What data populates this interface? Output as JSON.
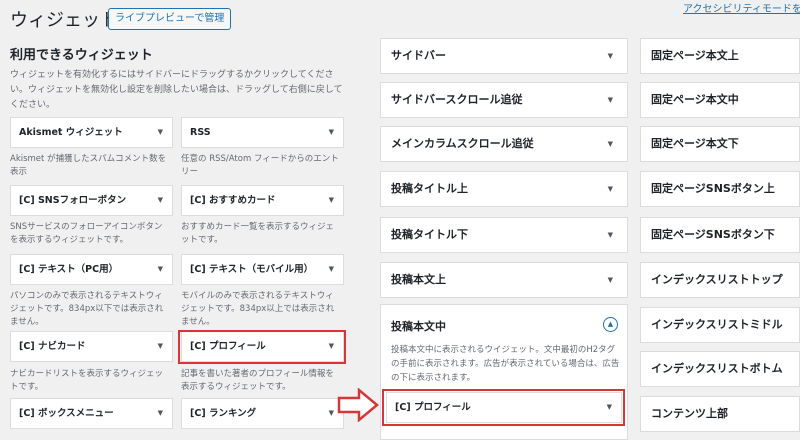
{
  "header": {
    "title": "ウィジェット",
    "live_preview_label": "ライブプレビューで管理",
    "accessibility_link": "アクセシビリティモードを有効"
  },
  "available": {
    "title": "利用できるウィジェット",
    "description": "ウィジェットを有効化するにはサイドバーにドラッグするかクリックしてください。ウィジェットを無効化し設定を削除したい場合は、ドラッグして右側に戻してください。"
  },
  "widgets": [
    {
      "name": "Akismet ウィジェット",
      "desc": "Akismet が捕獲したスパムコメント数を表示"
    },
    {
      "name": "RSS",
      "desc": "任意の RSS/Atom フィードからのエントリー"
    },
    {
      "name": "[C] SNSフォローボタン",
      "desc": "SNSサービスのフォローアイコンボタンを表示するウィジェットです。"
    },
    {
      "name": "[C] おすすめカード",
      "desc": "おすすめカード一覧を表示するウィジェットです。"
    },
    {
      "name": "[C] テキスト（PC用）",
      "desc": "パソコンのみで表示されるテキストウィジェットです。834px以下では表示されません。"
    },
    {
      "name": "[C] テキスト（モバイル用）",
      "desc": "モバイルのみで表示されるテキストウィジェットです。834px以上では表示されません。"
    },
    {
      "name": "[C] ナビカード",
      "desc": "ナビカードリストを表示するウィジェットです。"
    },
    {
      "name": "[C] プロフィール",
      "desc": "記事を書いた著者のプロフィール情報を表示するウィジェットです。"
    },
    {
      "name": "[C] ボックスメニュー",
      "desc": ""
    },
    {
      "name": "[C] ランキング",
      "desc": ""
    }
  ],
  "areas_left": [
    "サイドバー",
    "サイドバースクロール追従",
    "メインカラムスクロール追従",
    "投稿タイトル上",
    "投稿タイトル下",
    "投稿本文上"
  ],
  "open_area": {
    "title": "投稿本文中",
    "description": "投稿本文中に表示されるウイジェット。文中最初のH2タグの手前に表示されます。広告が表示されている場合は、広告の下に表示されます。",
    "placed_widget": "[C] プロフィール"
  },
  "areas_right": [
    "固定ページ本文上",
    "固定ページ本文中",
    "固定ページ本文下",
    "固定ページSNSボタン上",
    "固定ページSNSボタン下",
    "インデックスリストトップ",
    "インデックスリストミドル",
    "インデックスリストボトム",
    "コンテンツ上部"
  ],
  "colors": {
    "highlight": "#d63638",
    "link": "#2271b1"
  }
}
